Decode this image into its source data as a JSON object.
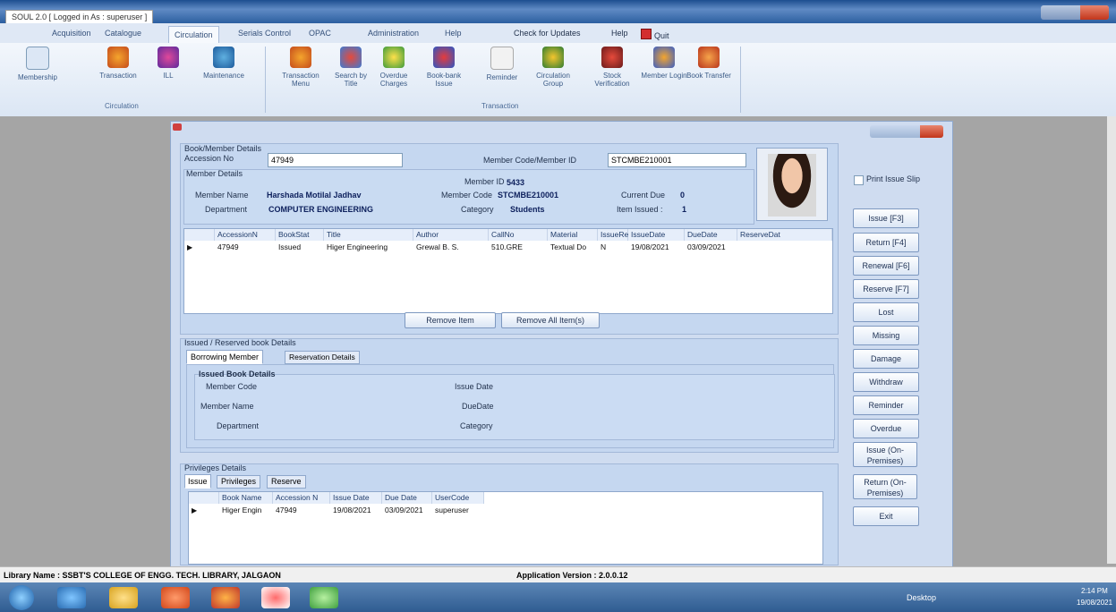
{
  "window": {
    "title": "SOUL 2.0 [ Logged in As : superuser ]"
  },
  "menu": {
    "items": [
      "Acquisition",
      "Catalogue",
      "Circulation",
      "Serials Control",
      "OPAC",
      "Administration",
      "Help"
    ],
    "check_updates": "Check for Updates",
    "help": "Help",
    "quit": "Quit"
  },
  "ribbon": {
    "group1_label": "Circulation",
    "group1": [
      "Membership",
      "Transaction",
      "ILL",
      "Maintenance"
    ],
    "group2_label": "Transaction",
    "group2": [
      "Transaction Menu",
      "Search by Title",
      "Overdue Charges",
      "Book-bank Issue",
      "Reminder",
      "Circulation Group",
      "Stock Verification",
      "Member Login",
      "Book Transfer"
    ]
  },
  "form": {
    "book_member_title": "Book/Member Details",
    "accession_label": "Accession No",
    "accession_value": "47949",
    "member_code_label": "Member Code/Member ID",
    "member_code_value": "STCMBE210001",
    "member_details_title": "Member Details",
    "member_id_label": "Member ID",
    "member_id_value": "5433",
    "member_name_label": "Member Name",
    "member_name_value": "Harshada  Motilal Jadhav",
    "member_code2_label": "Member Code",
    "member_code2_value": "STCMBE210001",
    "current_due_label": "Current Due",
    "current_due_value": "0",
    "department_label": "Department",
    "department_value": "COMPUTER ENGINEERING",
    "category_label": "Category",
    "category_value": "Students",
    "items_issued_label": "Item Issued :",
    "items_issued_value": "1",
    "print_issue_slip": "Print Issue Slip",
    "grid1": {
      "headers": [
        "AccessionN",
        "BookStat",
        "Title",
        "Author",
        "CallNo",
        "Material",
        "IssueRe",
        "IssueDate",
        "DueDate",
        "ReserveDat"
      ],
      "rows": [
        [
          "47949",
          "Issued",
          "Higer Engineering",
          "Grewal B. S.",
          "510.GRE",
          "Textual Do",
          "N",
          "19/08/2021",
          "03/09/2021",
          ""
        ]
      ]
    },
    "remove_item": "Remove Item",
    "remove_all": "Remove All Item(s)",
    "issued_reserved_title": "Issued / Reserved book Details",
    "tab_borrowing": "Borrowing Member",
    "tab_reservation": "Reservation Details",
    "issued_book_details": "Issued Book Details",
    "ib_member_code": "Member Code",
    "ib_member_name": "Member Name",
    "ib_department": "Department",
    "ib_issue_date": "Issue Date",
    "ib_due_date": "DueDate",
    "ib_category": "Category",
    "privileges_title": "Privileges Details",
    "tab_issue": "Issue",
    "tab_privileges": "Privileges",
    "tab_reserve": "Reserve",
    "grid2": {
      "headers": [
        "Book Name",
        "Accession N",
        "Issue Date",
        "Due Date",
        "UserCode"
      ],
      "rows": [
        [
          "Higer Engin",
          "47949",
          "19/08/2021",
          "03/09/2021",
          "superuser"
        ]
      ]
    },
    "side_buttons": [
      "Issue [F3]",
      "Return [F4]",
      "Renewal [F6]",
      "Reserve [F7]",
      "Lost",
      "Missing",
      "Damage",
      "Withdraw",
      "Reminder",
      "Overdue",
      "Issue (On-Premises)",
      "Return (On-Premises)",
      "Exit"
    ]
  },
  "status": {
    "library_name": "Library Name : SSBT'S COLLEGE OF ENGG.  TECH. LIBRARY, JALGAON",
    "app_version": "Application Version : 2.0.0.12"
  },
  "taskbar": {
    "desktop": "Desktop",
    "time": "2:14 PM",
    "date": "19/08/2021"
  },
  "colors": {
    "accent": "#cfdcf0",
    "selected_value": "#0c1f5c"
  }
}
